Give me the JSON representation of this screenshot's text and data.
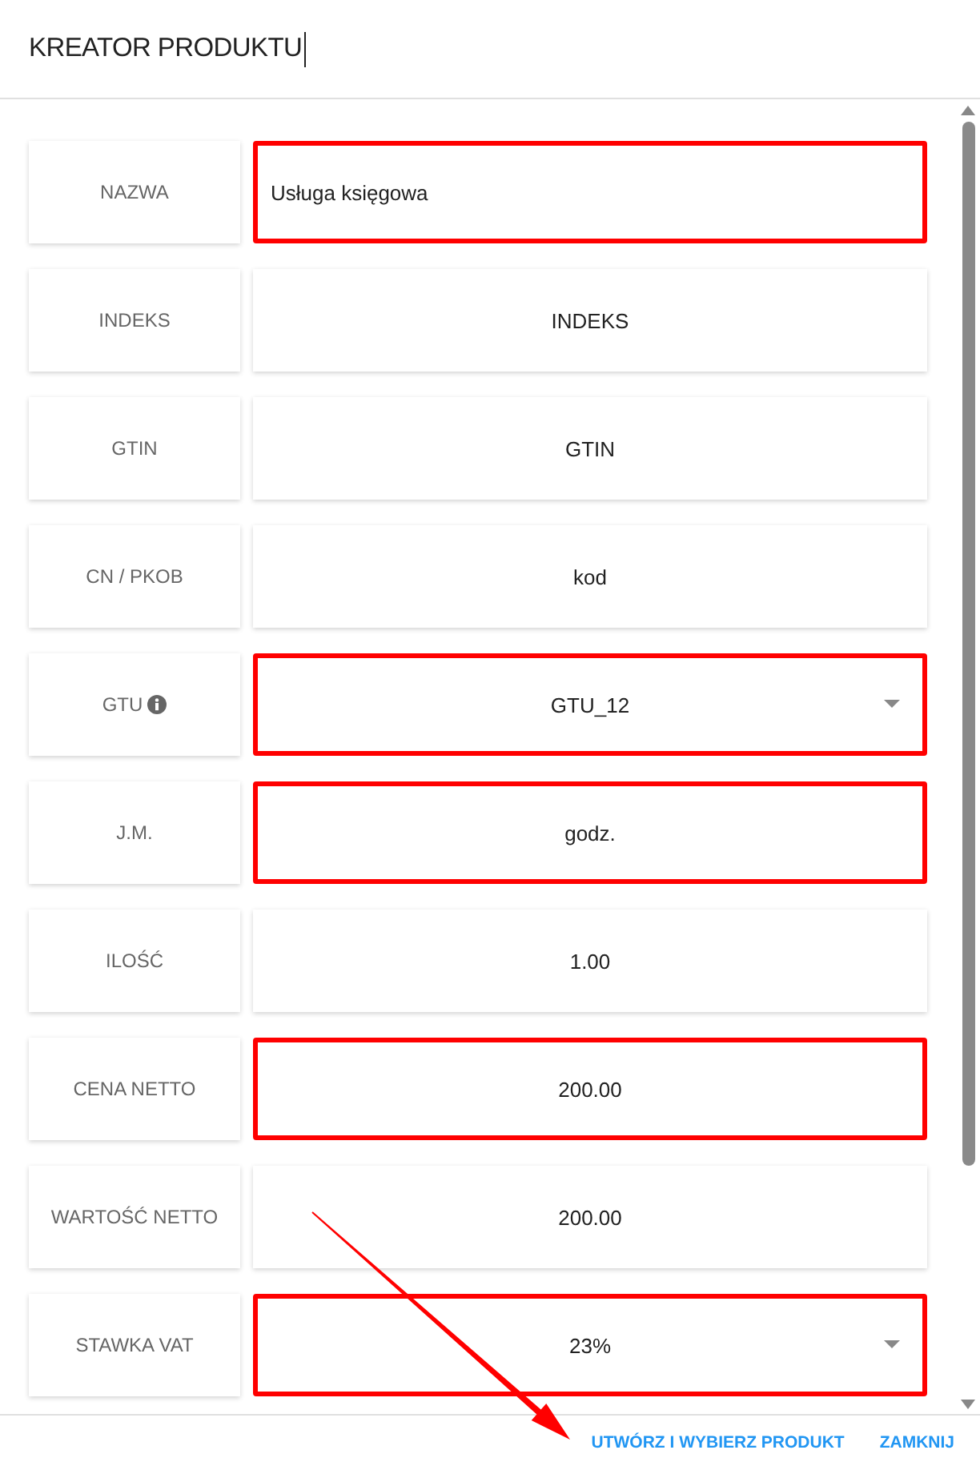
{
  "dialog": {
    "title": "KREATOR PRODUKTU",
    "title_editing": true
  },
  "rows": [
    {
      "label": "NAZWA",
      "info": false,
      "kind": "textarea",
      "value": "Usługa księgowa",
      "highlighted": true
    },
    {
      "label": "INDEKS",
      "info": false,
      "kind": "input",
      "value": "INDEKS",
      "highlighted": false
    },
    {
      "label": "GTIN",
      "info": false,
      "kind": "input",
      "value": "GTIN",
      "highlighted": false
    },
    {
      "label": "CN / PKOB",
      "info": false,
      "kind": "input",
      "value": "kod",
      "highlighted": false
    },
    {
      "label": "GTU",
      "info": true,
      "kind": "select",
      "value": "GTU_12",
      "highlighted": true
    },
    {
      "label": "J.M.",
      "info": false,
      "kind": "input",
      "value": "godz.",
      "highlighted": true
    },
    {
      "label": "ILOŚĆ",
      "info": false,
      "kind": "input",
      "value": "1.00",
      "highlighted": false
    },
    {
      "label": "CENA NETTO",
      "info": false,
      "kind": "input",
      "value": "200.00",
      "highlighted": true
    },
    {
      "label": "WARTOŚĆ NETTO",
      "info": false,
      "kind": "input",
      "value": "200.00",
      "highlighted": false
    },
    {
      "label": "STAWKA VAT",
      "info": false,
      "kind": "select",
      "value": "23%",
      "highlighted": true
    }
  ],
  "footer": {
    "buttons": [
      {
        "label": "UTWÓRZ I WYBIERZ PRODUKT"
      },
      {
        "label": "ZAMKNIJ"
      }
    ]
  },
  "annotations": [
    {
      "kind": "arrow"
    }
  ]
}
